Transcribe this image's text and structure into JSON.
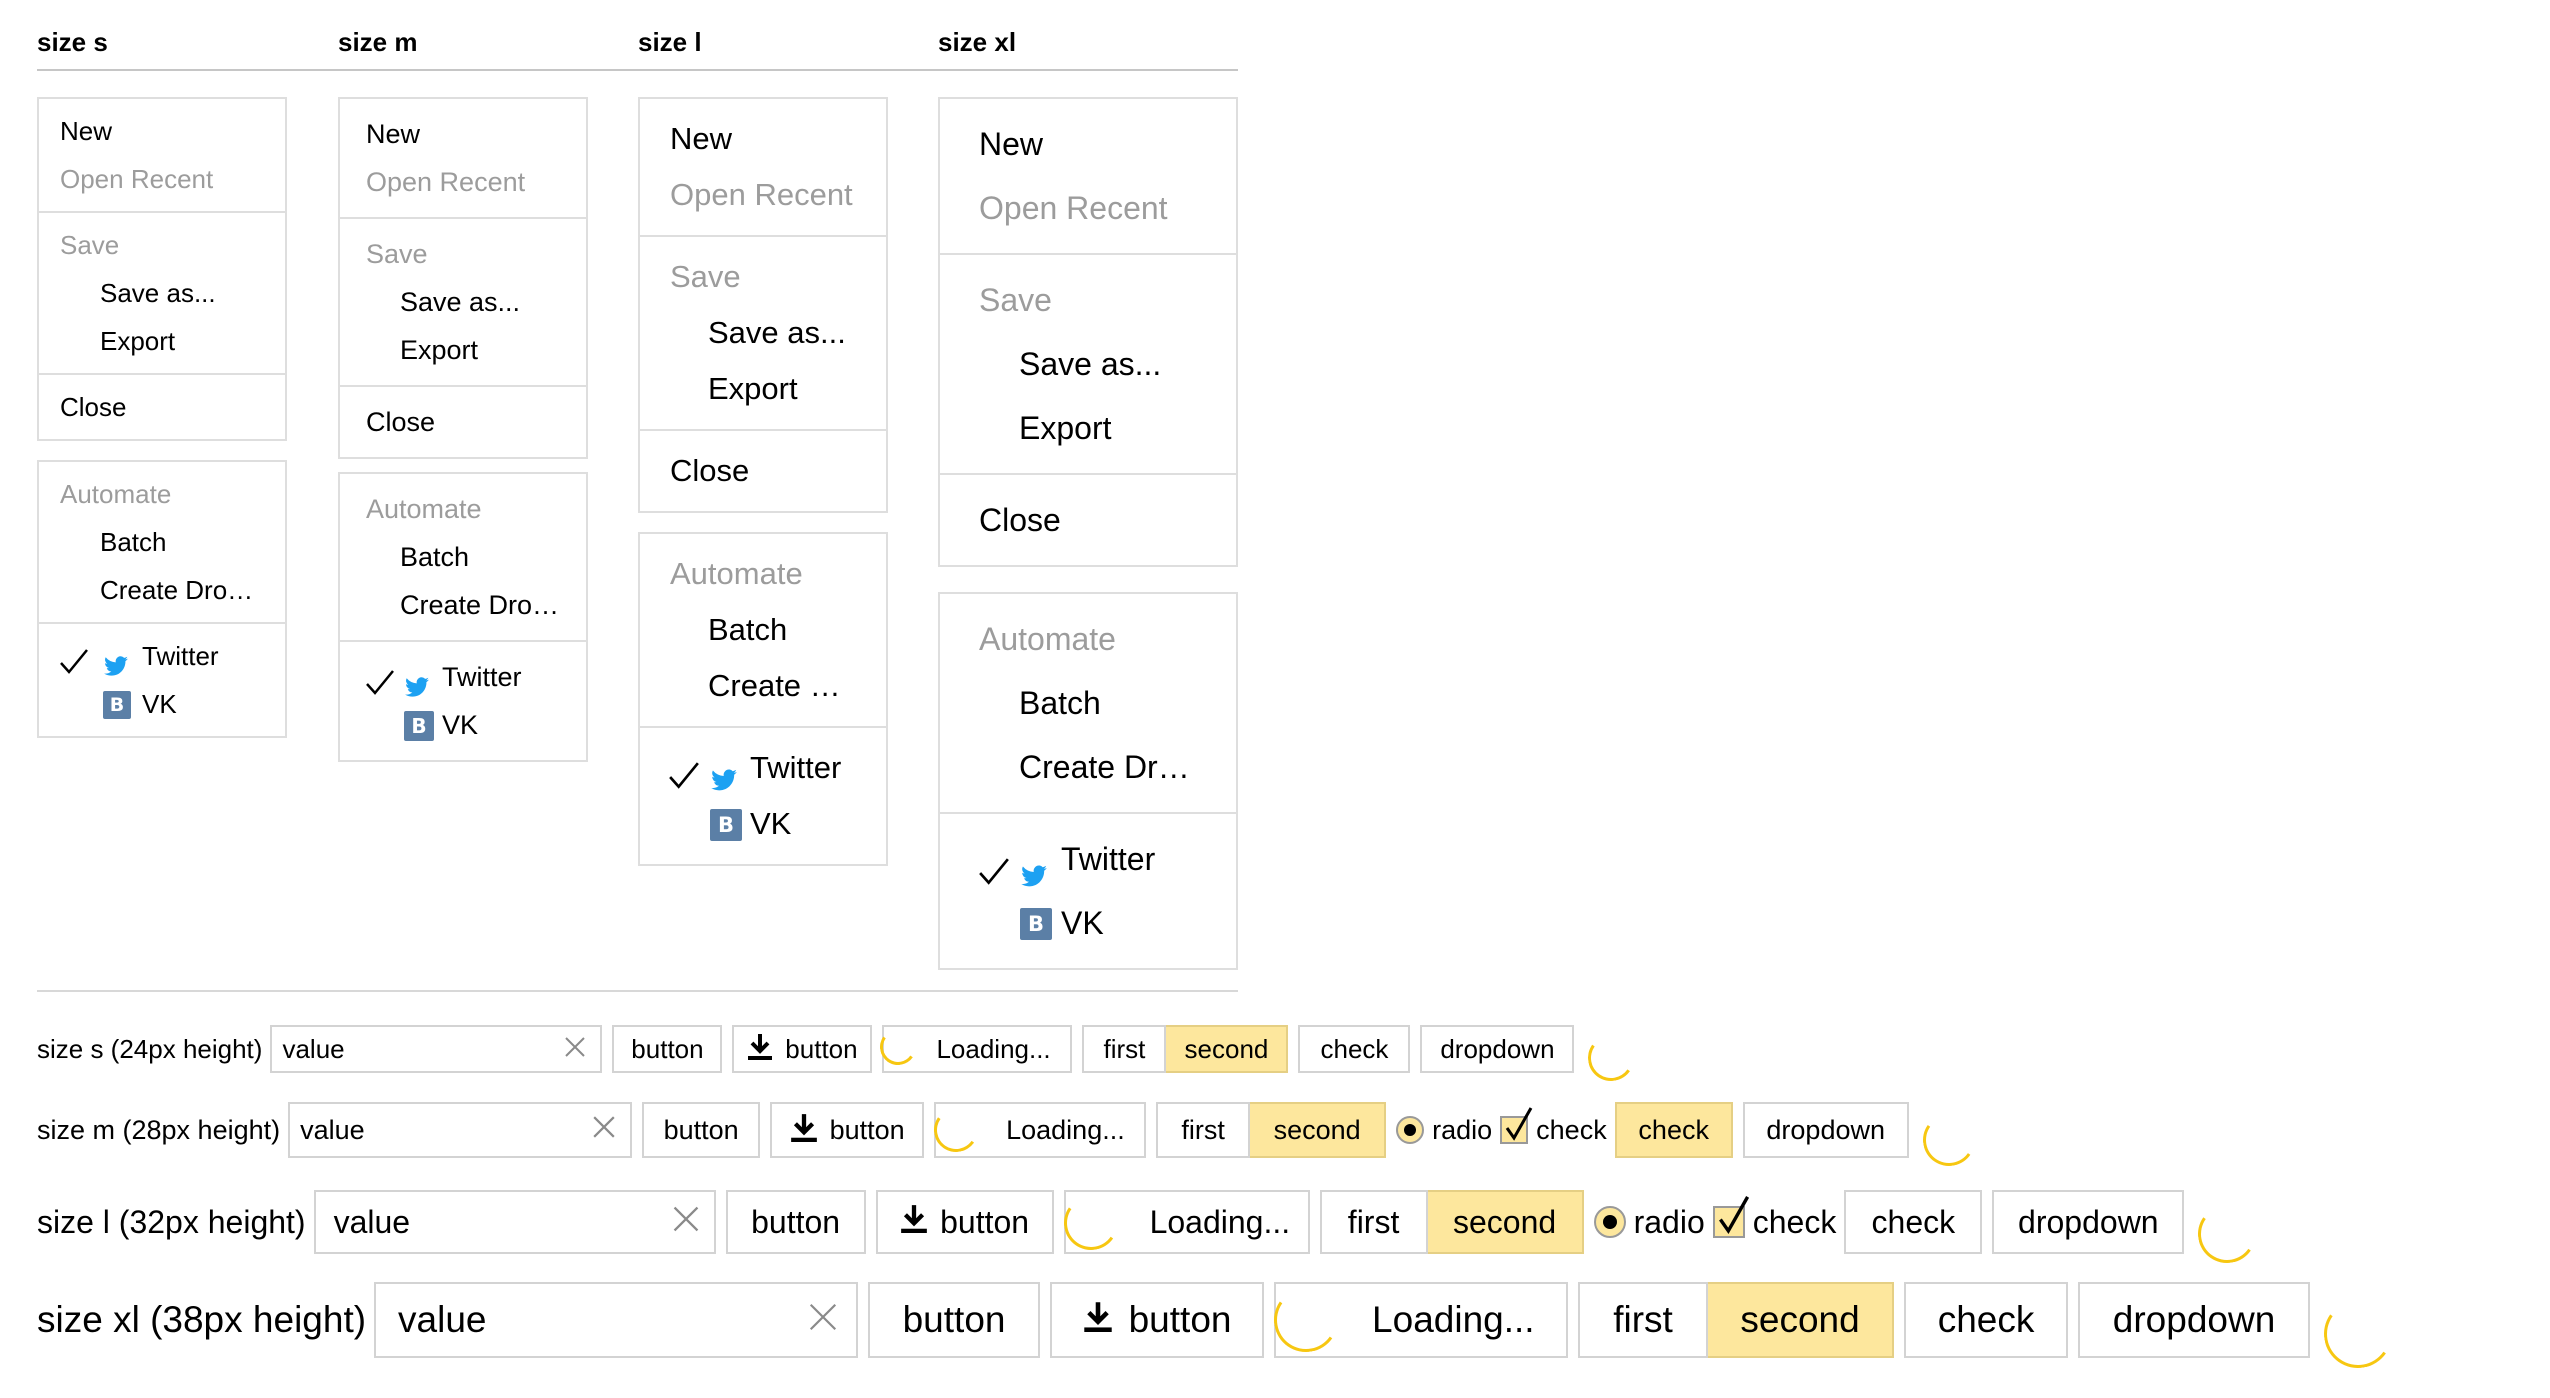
{
  "headers": [
    "size s",
    "size m",
    "size l",
    "size xl"
  ],
  "menu": {
    "new": "New",
    "open_recent": "Open Recent",
    "save": "Save",
    "save_as": "Save as...",
    "export": "Export",
    "close": "Close",
    "automate": "Automate",
    "batch": "Batch",
    "create_droplet": {
      "s": "Create Dro…",
      "m": "Create Dro…",
      "l": "Create …",
      "xl": "Create Dr…"
    },
    "twitter": "Twitter",
    "vk": "VK",
    "vk_icon_letter": "B",
    "twitter_color": "#1da1f2",
    "vk_color": "#5b7fa6"
  },
  "rows": {
    "s": {
      "label": "size s (24px height)",
      "input_value": "value",
      "button": "button",
      "icon_button": "button",
      "loading": "Loading...",
      "first": "first",
      "second": "second",
      "check": "check",
      "dropdown": "dropdown"
    },
    "m": {
      "label": "size m (28px height)",
      "input_value": "value",
      "button": "button",
      "icon_button": "button",
      "loading": "Loading...",
      "first": "first",
      "second": "second",
      "radio": "radio",
      "checkbox": "check",
      "check": "check",
      "dropdown": "dropdown"
    },
    "l": {
      "label": "size l (32px height)",
      "input_value": "value",
      "button": "button",
      "icon_button": "button",
      "loading": "Loading...",
      "first": "first",
      "second": "second",
      "radio": "radio",
      "checkbox": "check",
      "check": "check",
      "dropdown": "dropdown"
    },
    "xl": {
      "label": "size xl (38px height)",
      "input_value": "value",
      "button": "button",
      "icon_button": "button",
      "loading": "Loading...",
      "first": "first",
      "second": "second",
      "check": "check",
      "dropdown": "dropdown"
    }
  },
  "colors": {
    "accent_yellow": "#fde79d",
    "spinner": "#f7c711",
    "disabled_text": "#9c9c9c",
    "border": "#d3d3d3"
  },
  "icons": [
    "checkmark-icon",
    "twitter-icon",
    "vk-icon",
    "download-icon",
    "clear-icon",
    "spinner-icon"
  ]
}
